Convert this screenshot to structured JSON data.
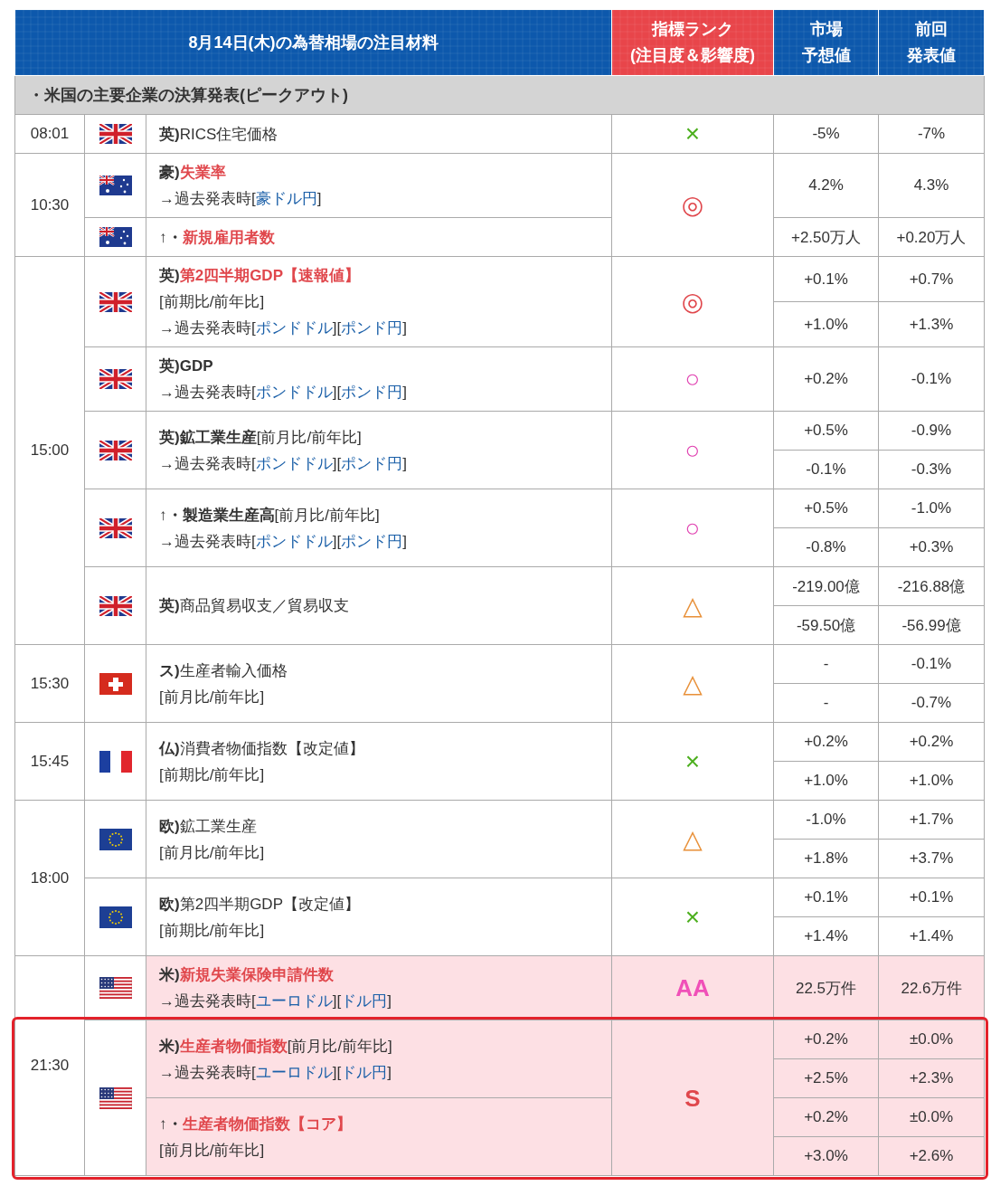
{
  "header": {
    "title": "8月14日(木)の為替相場の注目材料",
    "rank_heading": [
      "指標ランク",
      "(注目度＆影響度)"
    ],
    "forecast_heading": [
      "市場",
      "予想値"
    ],
    "previous_heading": [
      "前回",
      "発表値"
    ]
  },
  "section": "・米国の主要企業の決算発表(ピークアウト)",
  "slots": [
    {
      "time": "08:01",
      "releases": [
        {
          "rank": "×",
          "color": "#4caf1e",
          "highlighted": false,
          "outlined": false,
          "flags": [
            {
              "kind": "uk",
              "indicators": [
                {
                  "lines": [
                    [
                      {
                        "kind": "prefix",
                        "text": "英)"
                      },
                      {
                        "kind": "plain",
                        "text": "RICS住宅価格"
                      }
                    ]
                  ],
                  "values": [
                    {
                      "forecast": "-5%",
                      "previous": "-7%"
                    }
                  ]
                }
              ]
            }
          ]
        }
      ]
    },
    {
      "time": "10:30",
      "releases": [
        {
          "rank": "◎",
          "color": "#e0474c",
          "highlighted": false,
          "outlined": false,
          "flags": [
            {
              "kind": "au",
              "indicators": [
                {
                  "lines": [
                    [
                      {
                        "kind": "prefix",
                        "text": "豪)"
                      },
                      {
                        "kind": "title",
                        "text": "失業率"
                      }
                    ],
                    [
                      {
                        "kind": "plain",
                        "text": "→過去発表時["
                      },
                      {
                        "kind": "link",
                        "text": "豪ドル円"
                      },
                      {
                        "kind": "plain",
                        "text": "]"
                      }
                    ]
                  ],
                  "values": [
                    {
                      "forecast": "4.2%",
                      "previous": "4.3%"
                    }
                  ]
                }
              ]
            },
            {
              "kind": "au",
              "indicators": [
                {
                  "lines": [
                    [
                      {
                        "kind": "bold",
                        "text": "↑・"
                      },
                      {
                        "kind": "title",
                        "text": "新規雇用者数"
                      }
                    ]
                  ],
                  "values": [
                    {
                      "forecast": "+2.50万人",
                      "previous": "+0.20万人"
                    }
                  ]
                }
              ]
            }
          ]
        }
      ]
    },
    {
      "time": "15:00",
      "releases": [
        {
          "rank": "◎",
          "color": "#e0474c",
          "highlighted": false,
          "outlined": false,
          "flags": [
            {
              "kind": "uk",
              "indicators": [
                {
                  "lines": [
                    [
                      {
                        "kind": "prefix",
                        "text": "英)"
                      },
                      {
                        "kind": "title",
                        "text": "第2四半期GDP【速報値】"
                      }
                    ],
                    [
                      {
                        "kind": "plain",
                        "text": "[前期比/前年比]"
                      }
                    ],
                    [
                      {
                        "kind": "plain",
                        "text": "→過去発表時["
                      },
                      {
                        "kind": "link",
                        "text": "ポンドドル"
                      },
                      {
                        "kind": "plain",
                        "text": "]["
                      },
                      {
                        "kind": "link",
                        "text": "ポンド円"
                      },
                      {
                        "kind": "plain",
                        "text": "]"
                      }
                    ]
                  ],
                  "values": [
                    {
                      "forecast": "+0.1%",
                      "previous": "+0.7%"
                    },
                    {
                      "forecast": "+1.0%",
                      "previous": "+1.3%"
                    }
                  ]
                }
              ]
            }
          ]
        },
        {
          "rank": "○",
          "color": "#e040b0",
          "highlighted": false,
          "outlined": false,
          "flags": [
            {
              "kind": "uk",
              "indicators": [
                {
                  "lines": [
                    [
                      {
                        "kind": "prefix",
                        "text": "英)"
                      },
                      {
                        "kind": "bold",
                        "text": "GDP"
                      }
                    ],
                    [
                      {
                        "kind": "plain",
                        "text": "→過去発表時["
                      },
                      {
                        "kind": "link",
                        "text": "ポンドドル"
                      },
                      {
                        "kind": "plain",
                        "text": "]["
                      },
                      {
                        "kind": "link",
                        "text": "ポンド円"
                      },
                      {
                        "kind": "plain",
                        "text": "]"
                      }
                    ]
                  ],
                  "values": [
                    {
                      "forecast": "+0.2%",
                      "previous": "-0.1%"
                    }
                  ]
                }
              ]
            }
          ]
        },
        {
          "rank": "○",
          "color": "#e040b0",
          "highlighted": false,
          "outlined": false,
          "flags": [
            {
              "kind": "uk",
              "indicators": [
                {
                  "lines": [
                    [
                      {
                        "kind": "prefix",
                        "text": "英)"
                      },
                      {
                        "kind": "bold",
                        "text": "鉱工業生産"
                      },
                      {
                        "kind": "plain",
                        "text": "[前月比/前年比]"
                      }
                    ],
                    [
                      {
                        "kind": "plain",
                        "text": "→過去発表時["
                      },
                      {
                        "kind": "link",
                        "text": "ポンドドル"
                      },
                      {
                        "kind": "plain",
                        "text": "]["
                      },
                      {
                        "kind": "link",
                        "text": "ポンド円"
                      },
                      {
                        "kind": "plain",
                        "text": "]"
                      }
                    ]
                  ],
                  "values": [
                    {
                      "forecast": "+0.5%",
                      "previous": "-0.9%"
                    },
                    {
                      "forecast": "-0.1%",
                      "previous": "-0.3%"
                    }
                  ]
                }
              ]
            }
          ]
        },
        {
          "rank": "○",
          "color": "#e040b0",
          "highlighted": false,
          "outlined": false,
          "flags": [
            {
              "kind": "uk",
              "indicators": [
                {
                  "lines": [
                    [
                      {
                        "kind": "bold",
                        "text": "↑・製造業生産高"
                      },
                      {
                        "kind": "plain",
                        "text": "[前月比/前年比]"
                      }
                    ],
                    [
                      {
                        "kind": "plain",
                        "text": "→過去発表時["
                      },
                      {
                        "kind": "link",
                        "text": "ポンドドル"
                      },
                      {
                        "kind": "plain",
                        "text": "]["
                      },
                      {
                        "kind": "link",
                        "text": "ポンド円"
                      },
                      {
                        "kind": "plain",
                        "text": "]"
                      }
                    ]
                  ],
                  "values": [
                    {
                      "forecast": "+0.5%",
                      "previous": "-1.0%"
                    },
                    {
                      "forecast": "-0.8%",
                      "previous": "+0.3%"
                    }
                  ]
                }
              ]
            }
          ]
        },
        {
          "rank": "△",
          "color": "#e8913a",
          "highlighted": false,
          "outlined": false,
          "flags": [
            {
              "kind": "uk",
              "indicators": [
                {
                  "lines": [
                    [
                      {
                        "kind": "prefix",
                        "text": "英)"
                      },
                      {
                        "kind": "plain",
                        "text": "商品貿易収支／貿易収支"
                      }
                    ]
                  ],
                  "values": [
                    {
                      "forecast": "-219.00億",
                      "previous": "-216.88億"
                    },
                    {
                      "forecast": "-59.50億",
                      "previous": "-56.99億"
                    }
                  ]
                }
              ]
            }
          ]
        }
      ]
    },
    {
      "time": "15:30",
      "releases": [
        {
          "rank": "△",
          "color": "#e8913a",
          "highlighted": false,
          "outlined": false,
          "flags": [
            {
              "kind": "ch",
              "indicators": [
                {
                  "lines": [
                    [
                      {
                        "kind": "prefix",
                        "text": "ス)"
                      },
                      {
                        "kind": "plain",
                        "text": "生産者輸入価格"
                      }
                    ],
                    [
                      {
                        "kind": "plain",
                        "text": "[前月比/前年比]"
                      }
                    ]
                  ],
                  "values": [
                    {
                      "forecast": "-",
                      "previous": "-0.1%"
                    },
                    {
                      "forecast": "-",
                      "previous": "-0.7%"
                    }
                  ]
                }
              ]
            }
          ]
        }
      ]
    },
    {
      "time": "15:45",
      "releases": [
        {
          "rank": "×",
          "color": "#4caf1e",
          "highlighted": false,
          "outlined": false,
          "flags": [
            {
              "kind": "fr",
              "indicators": [
                {
                  "lines": [
                    [
                      {
                        "kind": "prefix",
                        "text": "仏)"
                      },
                      {
                        "kind": "plain",
                        "text": "消費者物価指数【改定値】"
                      }
                    ],
                    [
                      {
                        "kind": "plain",
                        "text": "[前期比/前年比]"
                      }
                    ]
                  ],
                  "values": [
                    {
                      "forecast": "+0.2%",
                      "previous": "+0.2%"
                    },
                    {
                      "forecast": "+1.0%",
                      "previous": "+1.0%"
                    }
                  ]
                }
              ]
            }
          ]
        }
      ]
    },
    {
      "time": "18:00",
      "releases": [
        {
          "rank": "△",
          "color": "#e8913a",
          "highlighted": false,
          "outlined": false,
          "flags": [
            {
              "kind": "eu",
              "indicators": [
                {
                  "lines": [
                    [
                      {
                        "kind": "prefix",
                        "text": "欧)"
                      },
                      {
                        "kind": "plain",
                        "text": "鉱工業生産"
                      }
                    ],
                    [
                      {
                        "kind": "plain",
                        "text": "[前月比/前年比]"
                      }
                    ]
                  ],
                  "values": [
                    {
                      "forecast": "-1.0%",
                      "previous": "+1.7%"
                    },
                    {
                      "forecast": "+1.8%",
                      "previous": "+3.7%"
                    }
                  ]
                }
              ]
            }
          ]
        },
        {
          "rank": "×",
          "color": "#4caf1e",
          "highlighted": false,
          "outlined": false,
          "flags": [
            {
              "kind": "eu",
              "indicators": [
                {
                  "lines": [
                    [
                      {
                        "kind": "prefix",
                        "text": "欧)"
                      },
                      {
                        "kind": "plain",
                        "text": "第2四半期GDP【改定値】"
                      }
                    ],
                    [
                      {
                        "kind": "plain",
                        "text": "[前期比/前年比]"
                      }
                    ]
                  ],
                  "values": [
                    {
                      "forecast": "+0.1%",
                      "previous": "+0.1%"
                    },
                    {
                      "forecast": "+1.4%",
                      "previous": "+1.4%"
                    }
                  ]
                }
              ]
            }
          ]
        }
      ]
    },
    {
      "time": "21:30",
      "releases": [
        {
          "rank": "AA",
          "color": "#f050b8",
          "highlighted": true,
          "outlined": false,
          "flags": [
            {
              "kind": "us",
              "indicators": [
                {
                  "lines": [
                    [
                      {
                        "kind": "prefix",
                        "text": "米)"
                      },
                      {
                        "kind": "title",
                        "text": "新規失業保険申請件数"
                      }
                    ],
                    [
                      {
                        "kind": "plain",
                        "text": "→過去発表時["
                      },
                      {
                        "kind": "link",
                        "text": "ユーロドル"
                      },
                      {
                        "kind": "plain",
                        "text": "]["
                      },
                      {
                        "kind": "link",
                        "text": "ドル円"
                      },
                      {
                        "kind": "plain",
                        "text": "]"
                      }
                    ]
                  ],
                  "values": [
                    {
                      "forecast": "22.5万件",
                      "previous": "22.6万件"
                    }
                  ]
                }
              ]
            }
          ]
        },
        {
          "rank": "S",
          "color": "#e0474c",
          "highlighted": true,
          "outlined": true,
          "flags": [
            {
              "kind": "us",
              "indicators": [
                {
                  "lines": [
                    [
                      {
                        "kind": "prefix",
                        "text": "米)"
                      },
                      {
                        "kind": "title",
                        "text": "生産者物価指数"
                      },
                      {
                        "kind": "plain",
                        "text": "[前月比/前年比]"
                      }
                    ],
                    [
                      {
                        "kind": "plain",
                        "text": "→過去発表時["
                      },
                      {
                        "kind": "link",
                        "text": "ユーロドル"
                      },
                      {
                        "kind": "plain",
                        "text": "]["
                      },
                      {
                        "kind": "link",
                        "text": "ドル円"
                      },
                      {
                        "kind": "plain",
                        "text": "]"
                      }
                    ]
                  ],
                  "values": [
                    {
                      "forecast": "+0.2%",
                      "previous": "±0.0%"
                    },
                    {
                      "forecast": "+2.5%",
                      "previous": "+2.3%"
                    }
                  ]
                },
                {
                  "lines": [
                    [
                      {
                        "kind": "bold",
                        "text": "↑・"
                      },
                      {
                        "kind": "title",
                        "text": "生産者物価指数【コア】"
                      }
                    ],
                    [
                      {
                        "kind": "plain",
                        "text": "[前月比/前年比]"
                      }
                    ]
                  ],
                  "values": [
                    {
                      "forecast": "+0.2%",
                      "previous": "±0.0%"
                    },
                    {
                      "forecast": "+3.0%",
                      "previous": "+2.6%"
                    }
                  ]
                }
              ]
            }
          ]
        }
      ]
    }
  ]
}
